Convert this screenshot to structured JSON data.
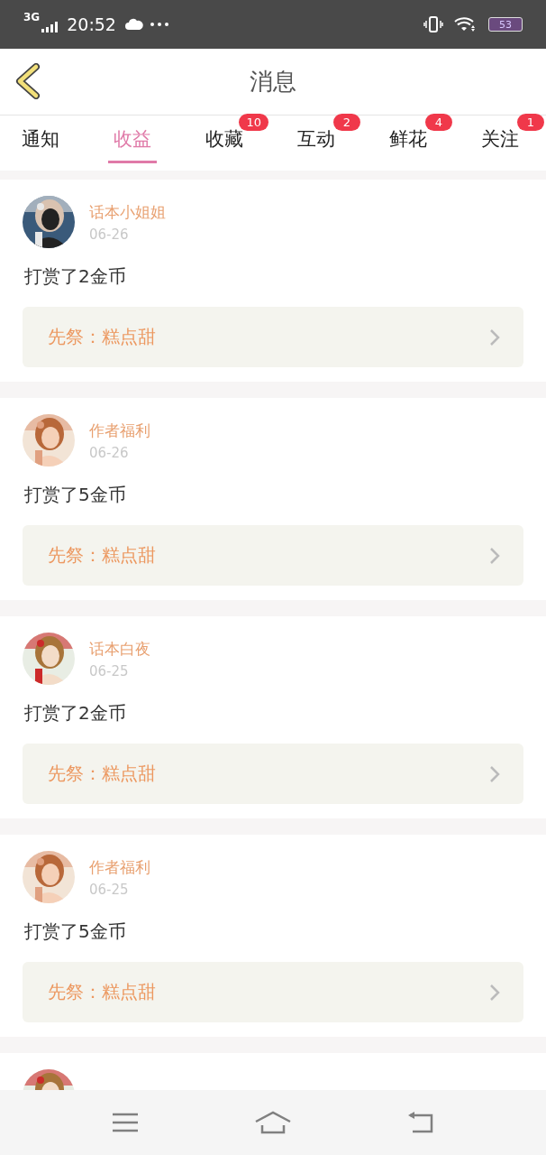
{
  "status_bar": {
    "network": "3G",
    "time": "20:52",
    "battery": "53"
  },
  "header": {
    "title": "消息"
  },
  "tabs": [
    {
      "label": "通知",
      "selected": false
    },
    {
      "label": "收益",
      "selected": true
    },
    {
      "label": "收藏",
      "selected": false,
      "badge": "10"
    },
    {
      "label": "互动",
      "selected": false,
      "badge": "2"
    },
    {
      "label": "鲜花",
      "selected": false,
      "badge": "4"
    },
    {
      "label": "关注",
      "selected": false,
      "badge": "1"
    }
  ],
  "messages": [
    {
      "avatar": {
        "kind": "picture"
      },
      "name": "话本小姐姐",
      "date": "06-26",
      "text": "打赏了2金币",
      "link": "先祭：糕点甜"
    },
    {
      "avatar": {
        "kind": "picture"
      },
      "name": "作者福利",
      "date": "06-26",
      "text": "打赏了5金币",
      "link": "先祭：糕点甜"
    },
    {
      "avatar": {
        "kind": "picture"
      },
      "name": "话本白夜",
      "date": "06-25",
      "text": "打赏了2金币",
      "link": "先祭：糕点甜"
    },
    {
      "avatar": {
        "kind": "picture"
      },
      "name": "作者福利",
      "date": "06-25",
      "text": "打赏了5金币",
      "link": "先祭：糕点甜"
    },
    {
      "avatar": {
        "kind": "picture"
      }
    }
  ]
}
